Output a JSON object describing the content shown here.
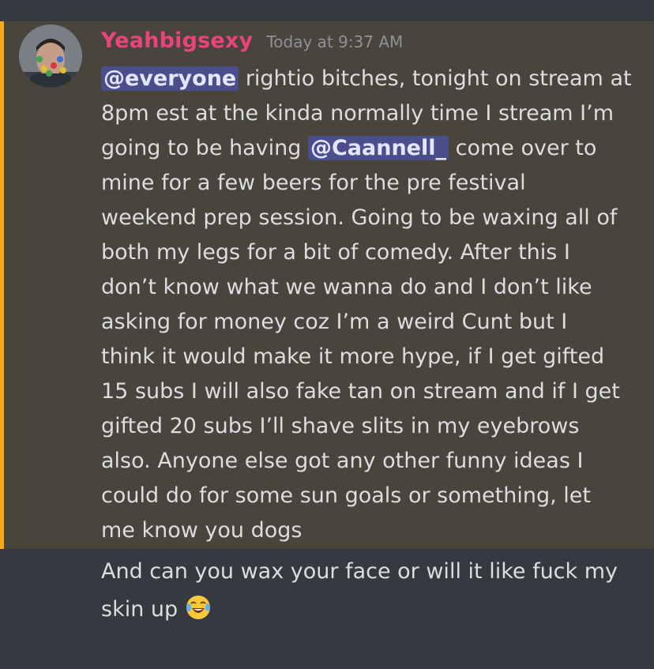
{
  "message": {
    "author": "Yeahbigsexy",
    "timestamp": "Today at 9:37 AM",
    "lines": [
      {
        "mention": "@everyone",
        "rest": " rightio bitches, tonight on stream at"
      },
      {
        "text": "8pm est at the kinda normally time I stream I’m"
      },
      {
        "pre": "going to be having ",
        "mention": "@Caannell_",
        "rest": " come over to"
      },
      {
        "text": "mine for a few beers for the pre festival"
      },
      {
        "text": "weekend prep session. Going to be waxing all of"
      },
      {
        "text": "both my legs for a bit of comedy. After this I"
      },
      {
        "text": "don’t know what we wanna do and I don’t like"
      },
      {
        "text": "asking for money coz I’m a weird Cunt but I"
      },
      {
        "text": "think it would make it more hype, if I get gifted"
      },
      {
        "text": "15 subs I will also fake tan on stream and if I get"
      },
      {
        "text": "gifted 20 subs I’ll shave slits in my eyebrows"
      },
      {
        "text": "also. Anyone else got any other funny ideas I"
      },
      {
        "text": "could do for some sun goals or something, let"
      },
      {
        "text": "me know you dogs"
      }
    ]
  },
  "followup": {
    "line1": "And can you wax your face or will it like fuck my",
    "line2": "skin up"
  },
  "colors": {
    "background": "#36393f",
    "highlight": "#49443c",
    "highlight_bar": "#faa61a",
    "username": "#e9457c",
    "mention_bg": "#4a4e8a"
  },
  "icons": {
    "emoji": "joy-emoji-icon"
  }
}
